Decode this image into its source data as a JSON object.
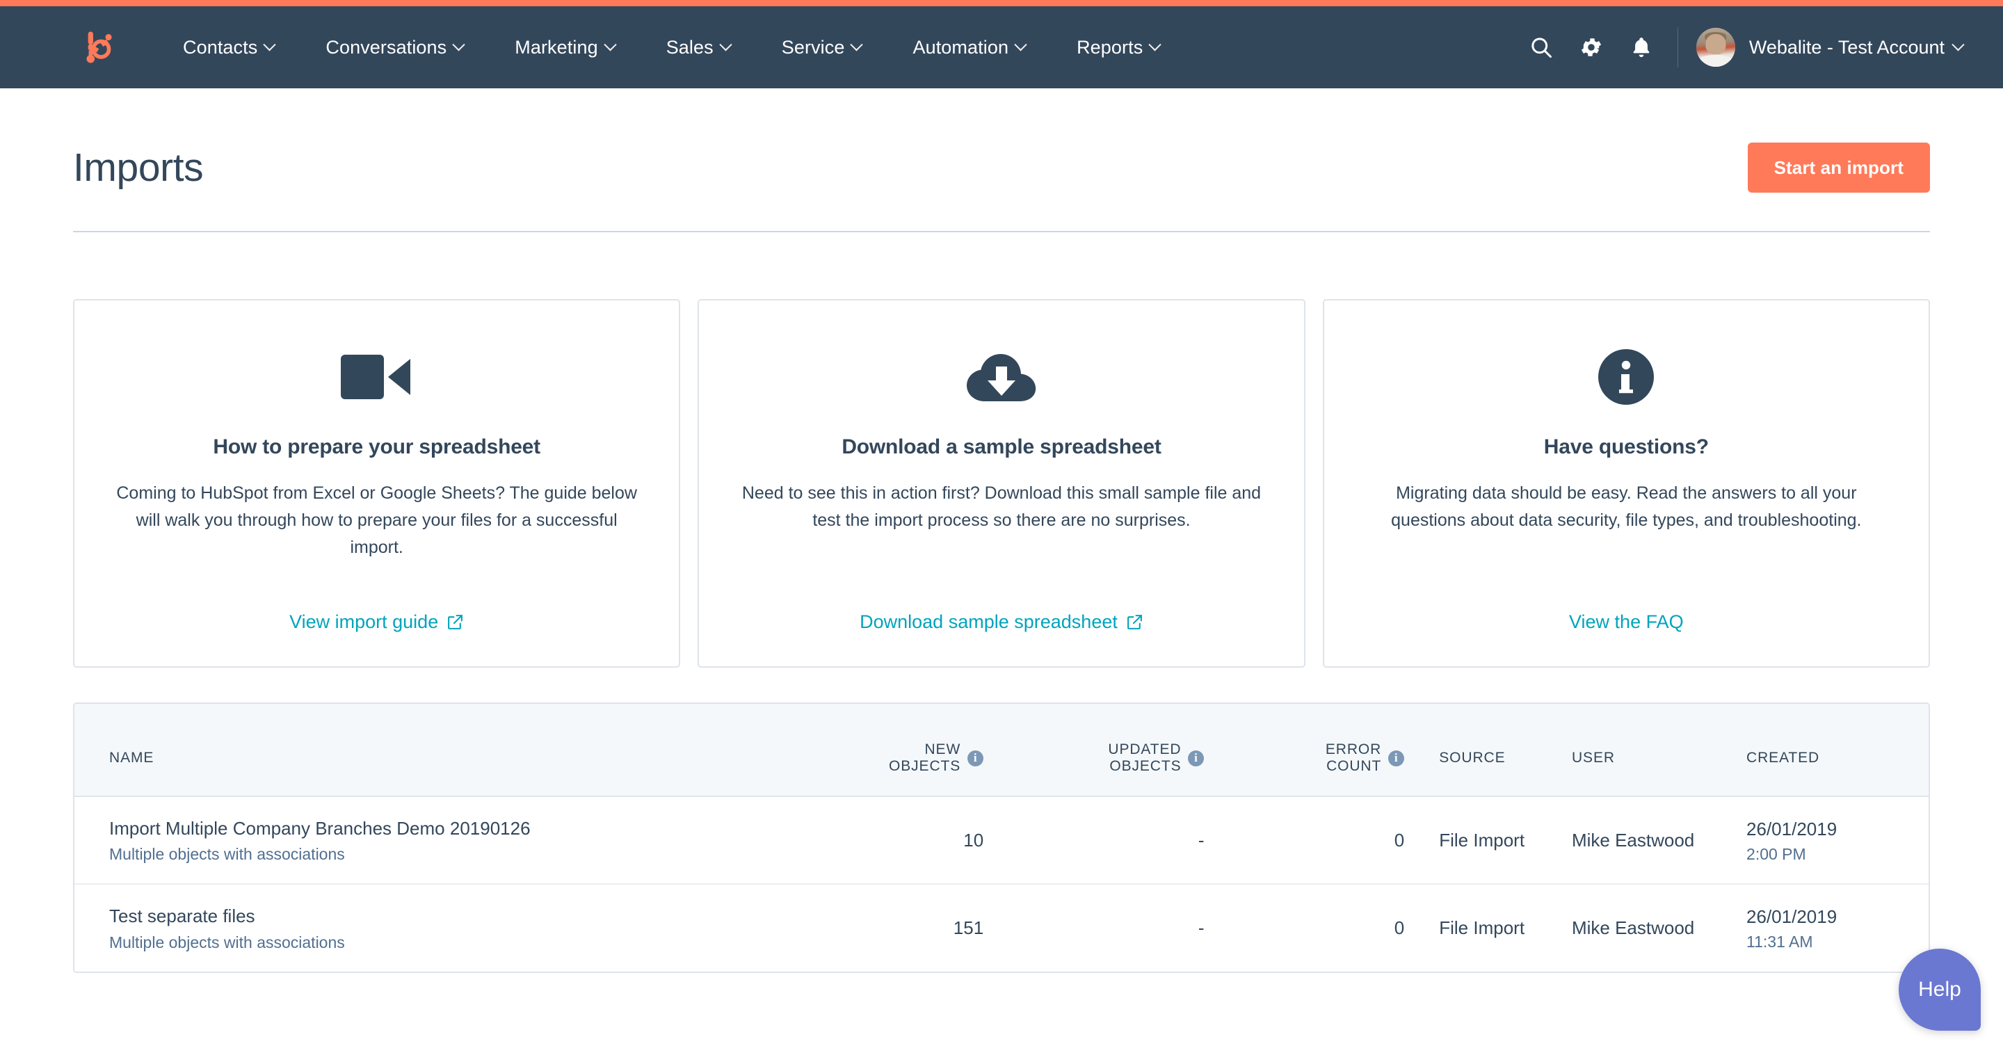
{
  "theme": {
    "accent_orange": "#ff7a59",
    "nav_background": "#33475b",
    "link_teal": "#00a4bd",
    "help_purple": "#6a78d1",
    "border": "#dfe3eb"
  },
  "navbar": {
    "logo_name": "hubspot-logo",
    "items": [
      {
        "label": "Contacts"
      },
      {
        "label": "Conversations"
      },
      {
        "label": "Marketing"
      },
      {
        "label": "Sales"
      },
      {
        "label": "Service"
      },
      {
        "label": "Automation"
      },
      {
        "label": "Reports"
      }
    ],
    "icons": [
      {
        "name": "search-icon"
      },
      {
        "name": "gear-icon"
      },
      {
        "name": "bell-icon"
      }
    ],
    "account": {
      "name": "Webalite - Test Account"
    }
  },
  "header": {
    "title": "Imports",
    "start_import_label": "Start an import"
  },
  "cards": [
    {
      "icon": "video-camera-icon",
      "title": "How to prepare your spreadsheet",
      "body": "Coming to HubSpot from Excel or Google Sheets? The guide below will walk you through how to prepare your files for a successful import.",
      "link": "View import guide",
      "link_icon": "external-link-icon"
    },
    {
      "icon": "cloud-download-icon",
      "title": "Download a sample spreadsheet",
      "body": "Need to see this in action first? Download this small sample file and test the import process so there are no surprises.",
      "link": "Download sample spreadsheet",
      "link_icon": "external-link-icon"
    },
    {
      "icon": "info-circle-icon",
      "title": "Have questions?",
      "body": "Migrating data should be easy. Read the answers to all your questions about data security, file types, and troubleshooting.",
      "link": "View the FAQ",
      "link_icon": "none"
    }
  ],
  "table": {
    "columns": [
      {
        "label": "NAME",
        "info": false
      },
      {
        "label": "NEW\nOBJECTS",
        "info": true
      },
      {
        "label": "UPDATED\nOBJECTS",
        "info": true
      },
      {
        "label": "ERROR\nCOUNT",
        "info": true
      },
      {
        "label": "SOURCE",
        "info": false
      },
      {
        "label": "USER",
        "info": false
      },
      {
        "label": "CREATED",
        "info": false
      }
    ],
    "rows": [
      {
        "name": "Import Multiple Company Branches Demo 20190126",
        "subtitle": "Multiple objects with associations",
        "new_objects": "10",
        "updated_objects": "-",
        "error_count": "0",
        "source": "File Import",
        "user": "Mike Eastwood",
        "created_date": "26/01/2019",
        "created_time": "2:00 PM"
      },
      {
        "name": "Test separate files",
        "subtitle": "Multiple objects with associations",
        "new_objects": "151",
        "updated_objects": "-",
        "error_count": "0",
        "source": "File Import",
        "user": "Mike Eastwood",
        "created_date": "26/01/2019",
        "created_time": "11:31 AM"
      }
    ]
  },
  "help": {
    "label": "Help"
  }
}
